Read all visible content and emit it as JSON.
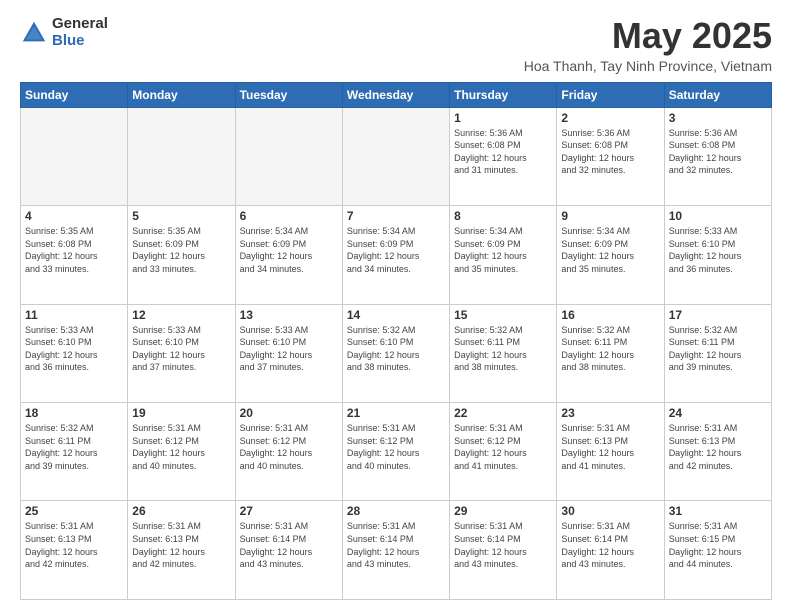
{
  "logo": {
    "general": "General",
    "blue": "Blue"
  },
  "title": "May 2025",
  "subtitle": "Hoa Thanh, Tay Ninh Province, Vietnam",
  "days_of_week": [
    "Sunday",
    "Monday",
    "Tuesday",
    "Wednesday",
    "Thursday",
    "Friday",
    "Saturday"
  ],
  "weeks": [
    [
      {
        "day": "",
        "info": ""
      },
      {
        "day": "",
        "info": ""
      },
      {
        "day": "",
        "info": ""
      },
      {
        "day": "",
        "info": ""
      },
      {
        "day": "1",
        "info": "Sunrise: 5:36 AM\nSunset: 6:08 PM\nDaylight: 12 hours\nand 31 minutes."
      },
      {
        "day": "2",
        "info": "Sunrise: 5:36 AM\nSunset: 6:08 PM\nDaylight: 12 hours\nand 32 minutes."
      },
      {
        "day": "3",
        "info": "Sunrise: 5:36 AM\nSunset: 6:08 PM\nDaylight: 12 hours\nand 32 minutes."
      }
    ],
    [
      {
        "day": "4",
        "info": "Sunrise: 5:35 AM\nSunset: 6:08 PM\nDaylight: 12 hours\nand 33 minutes."
      },
      {
        "day": "5",
        "info": "Sunrise: 5:35 AM\nSunset: 6:09 PM\nDaylight: 12 hours\nand 33 minutes."
      },
      {
        "day": "6",
        "info": "Sunrise: 5:34 AM\nSunset: 6:09 PM\nDaylight: 12 hours\nand 34 minutes."
      },
      {
        "day": "7",
        "info": "Sunrise: 5:34 AM\nSunset: 6:09 PM\nDaylight: 12 hours\nand 34 minutes."
      },
      {
        "day": "8",
        "info": "Sunrise: 5:34 AM\nSunset: 6:09 PM\nDaylight: 12 hours\nand 35 minutes."
      },
      {
        "day": "9",
        "info": "Sunrise: 5:34 AM\nSunset: 6:09 PM\nDaylight: 12 hours\nand 35 minutes."
      },
      {
        "day": "10",
        "info": "Sunrise: 5:33 AM\nSunset: 6:10 PM\nDaylight: 12 hours\nand 36 minutes."
      }
    ],
    [
      {
        "day": "11",
        "info": "Sunrise: 5:33 AM\nSunset: 6:10 PM\nDaylight: 12 hours\nand 36 minutes."
      },
      {
        "day": "12",
        "info": "Sunrise: 5:33 AM\nSunset: 6:10 PM\nDaylight: 12 hours\nand 37 minutes."
      },
      {
        "day": "13",
        "info": "Sunrise: 5:33 AM\nSunset: 6:10 PM\nDaylight: 12 hours\nand 37 minutes."
      },
      {
        "day": "14",
        "info": "Sunrise: 5:32 AM\nSunset: 6:10 PM\nDaylight: 12 hours\nand 38 minutes."
      },
      {
        "day": "15",
        "info": "Sunrise: 5:32 AM\nSunset: 6:11 PM\nDaylight: 12 hours\nand 38 minutes."
      },
      {
        "day": "16",
        "info": "Sunrise: 5:32 AM\nSunset: 6:11 PM\nDaylight: 12 hours\nand 38 minutes."
      },
      {
        "day": "17",
        "info": "Sunrise: 5:32 AM\nSunset: 6:11 PM\nDaylight: 12 hours\nand 39 minutes."
      }
    ],
    [
      {
        "day": "18",
        "info": "Sunrise: 5:32 AM\nSunset: 6:11 PM\nDaylight: 12 hours\nand 39 minutes."
      },
      {
        "day": "19",
        "info": "Sunrise: 5:31 AM\nSunset: 6:12 PM\nDaylight: 12 hours\nand 40 minutes."
      },
      {
        "day": "20",
        "info": "Sunrise: 5:31 AM\nSunset: 6:12 PM\nDaylight: 12 hours\nand 40 minutes."
      },
      {
        "day": "21",
        "info": "Sunrise: 5:31 AM\nSunset: 6:12 PM\nDaylight: 12 hours\nand 40 minutes."
      },
      {
        "day": "22",
        "info": "Sunrise: 5:31 AM\nSunset: 6:12 PM\nDaylight: 12 hours\nand 41 minutes."
      },
      {
        "day": "23",
        "info": "Sunrise: 5:31 AM\nSunset: 6:13 PM\nDaylight: 12 hours\nand 41 minutes."
      },
      {
        "day": "24",
        "info": "Sunrise: 5:31 AM\nSunset: 6:13 PM\nDaylight: 12 hours\nand 42 minutes."
      }
    ],
    [
      {
        "day": "25",
        "info": "Sunrise: 5:31 AM\nSunset: 6:13 PM\nDaylight: 12 hours\nand 42 minutes."
      },
      {
        "day": "26",
        "info": "Sunrise: 5:31 AM\nSunset: 6:13 PM\nDaylight: 12 hours\nand 42 minutes."
      },
      {
        "day": "27",
        "info": "Sunrise: 5:31 AM\nSunset: 6:14 PM\nDaylight: 12 hours\nand 43 minutes."
      },
      {
        "day": "28",
        "info": "Sunrise: 5:31 AM\nSunset: 6:14 PM\nDaylight: 12 hours\nand 43 minutes."
      },
      {
        "day": "29",
        "info": "Sunrise: 5:31 AM\nSunset: 6:14 PM\nDaylight: 12 hours\nand 43 minutes."
      },
      {
        "day": "30",
        "info": "Sunrise: 5:31 AM\nSunset: 6:14 PM\nDaylight: 12 hours\nand 43 minutes."
      },
      {
        "day": "31",
        "info": "Sunrise: 5:31 AM\nSunset: 6:15 PM\nDaylight: 12 hours\nand 44 minutes."
      }
    ]
  ],
  "empty_cols_week1": 4
}
